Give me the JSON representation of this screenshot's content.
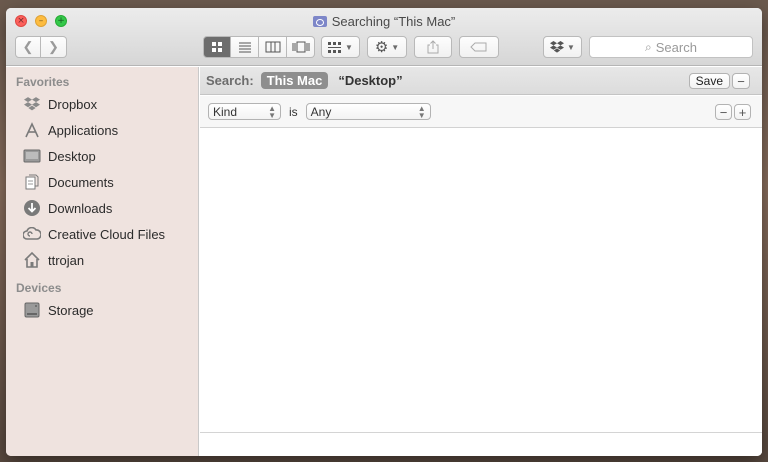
{
  "window": {
    "title": "Searching “This Mac”"
  },
  "toolbar": {
    "back_icon": "chevron-left-icon",
    "forward_icon": "chevron-right-icon",
    "views": [
      "icon-view-icon",
      "list-view-icon",
      "column-view-icon",
      "cover-flow-icon"
    ],
    "arrange_icon": "arrange-grid-icon",
    "action_icon": "gear-icon",
    "share_icon": "share-icon",
    "tag_icon": "tag-icon",
    "dropbox_icon": "dropbox-icon",
    "search": {
      "placeholder": "Search",
      "value": ""
    }
  },
  "sidebar": {
    "favorites_heading": "Favorites",
    "favorites": [
      {
        "label": "Dropbox",
        "icon": "dropbox-icon"
      },
      {
        "label": "Applications",
        "icon": "applications-icon"
      },
      {
        "label": "Desktop",
        "icon": "desktop-icon"
      },
      {
        "label": "Documents",
        "icon": "documents-icon"
      },
      {
        "label": "Downloads",
        "icon": "downloads-icon"
      },
      {
        "label": "Creative Cloud Files",
        "icon": "creative-cloud-icon"
      },
      {
        "label": "ttrojan",
        "icon": "home-icon"
      }
    ],
    "devices_heading": "Devices",
    "devices": [
      {
        "label": "Storage",
        "icon": "disk-icon"
      }
    ]
  },
  "searchbar": {
    "label": "Search:",
    "scope_this_mac": "This Mac",
    "scope_desktop": "“Desktop”",
    "save_label": "Save"
  },
  "criteria": {
    "attribute": "Kind",
    "operator": "is",
    "value": "Any"
  }
}
